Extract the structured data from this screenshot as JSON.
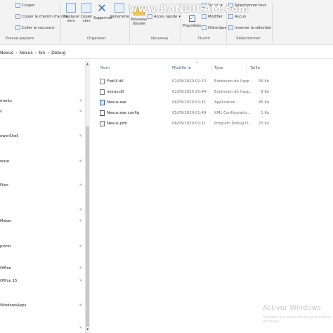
{
  "ribbon": {
    "clipboard": {
      "cut": "Couper",
      "copy_path": "Copier le chemin d'accès",
      "paste_shortcut": "Coller le raccourci",
      "group_label": "Presse-papiers"
    },
    "organize": {
      "move_to": "Déplacer vers",
      "copy_to": "Copier vers",
      "delete": "Supprimer",
      "rename": "Renommer",
      "group_label": "Organiser"
    },
    "new": {
      "new_folder": "Nouveau dossier",
      "quick_access": "Accès rapide",
      "group_label": "Nouveau"
    },
    "open": {
      "properties": "Propriétés",
      "open": "Ouvrir",
      "modify": "Modifier",
      "history": "Historique",
      "group_label": "Ouvrir"
    },
    "select": {
      "select_all": "Sélectionner tout",
      "select_none": "Aucun",
      "invert": "Inverser la sélection",
      "group_label": "Sélectionner"
    }
  },
  "watermark": "www.BANDICAM.com",
  "breadcrumb": [
    "Nexus",
    "Nexus",
    "bin",
    "Debug"
  ],
  "nav_items": [
    "ments",
    "s",
    "owerShell",
    "ware",
    "Files",
    "Maker",
    "plorer",
    "Office",
    "Office 15",
    "WindowsApps"
  ],
  "columns": {
    "name": "Nom",
    "modified": "Modifié le",
    "type": "Type",
    "size": "Taille"
  },
  "files": [
    {
      "name": "FlatUI.dll",
      "modified": "02/05/2020 02:12",
      "type": "Extension de l'app...",
      "size": "56 Ko",
      "icon": "dll-file-icon"
    },
    {
      "name": "nexus.dll",
      "modified": "02/05/2020 20:44",
      "type": "Extension de l'app...",
      "size": "9 Ko",
      "icon": "dll-file-icon"
    },
    {
      "name": "Nexus.exe",
      "modified": "06/05/2020 02:11",
      "type": "Application",
      "size": "45 Ko",
      "icon": "exe-file-icon"
    },
    {
      "name": "Nexus.exe.config",
      "modified": "05/05/2020 01:49",
      "type": "XML Configuratio...",
      "size": "1 Ko",
      "icon": "config-file-icon"
    },
    {
      "name": "Nexus.pdb",
      "modified": "06/05/2020 02:11",
      "type": "Program Debug D...",
      "size": "70 Ko",
      "icon": "pdb-file-icon"
    }
  ],
  "activation": {
    "title": "Activer Windows",
    "subtitle": "Accédez aux paramètres pour activer Windows."
  }
}
